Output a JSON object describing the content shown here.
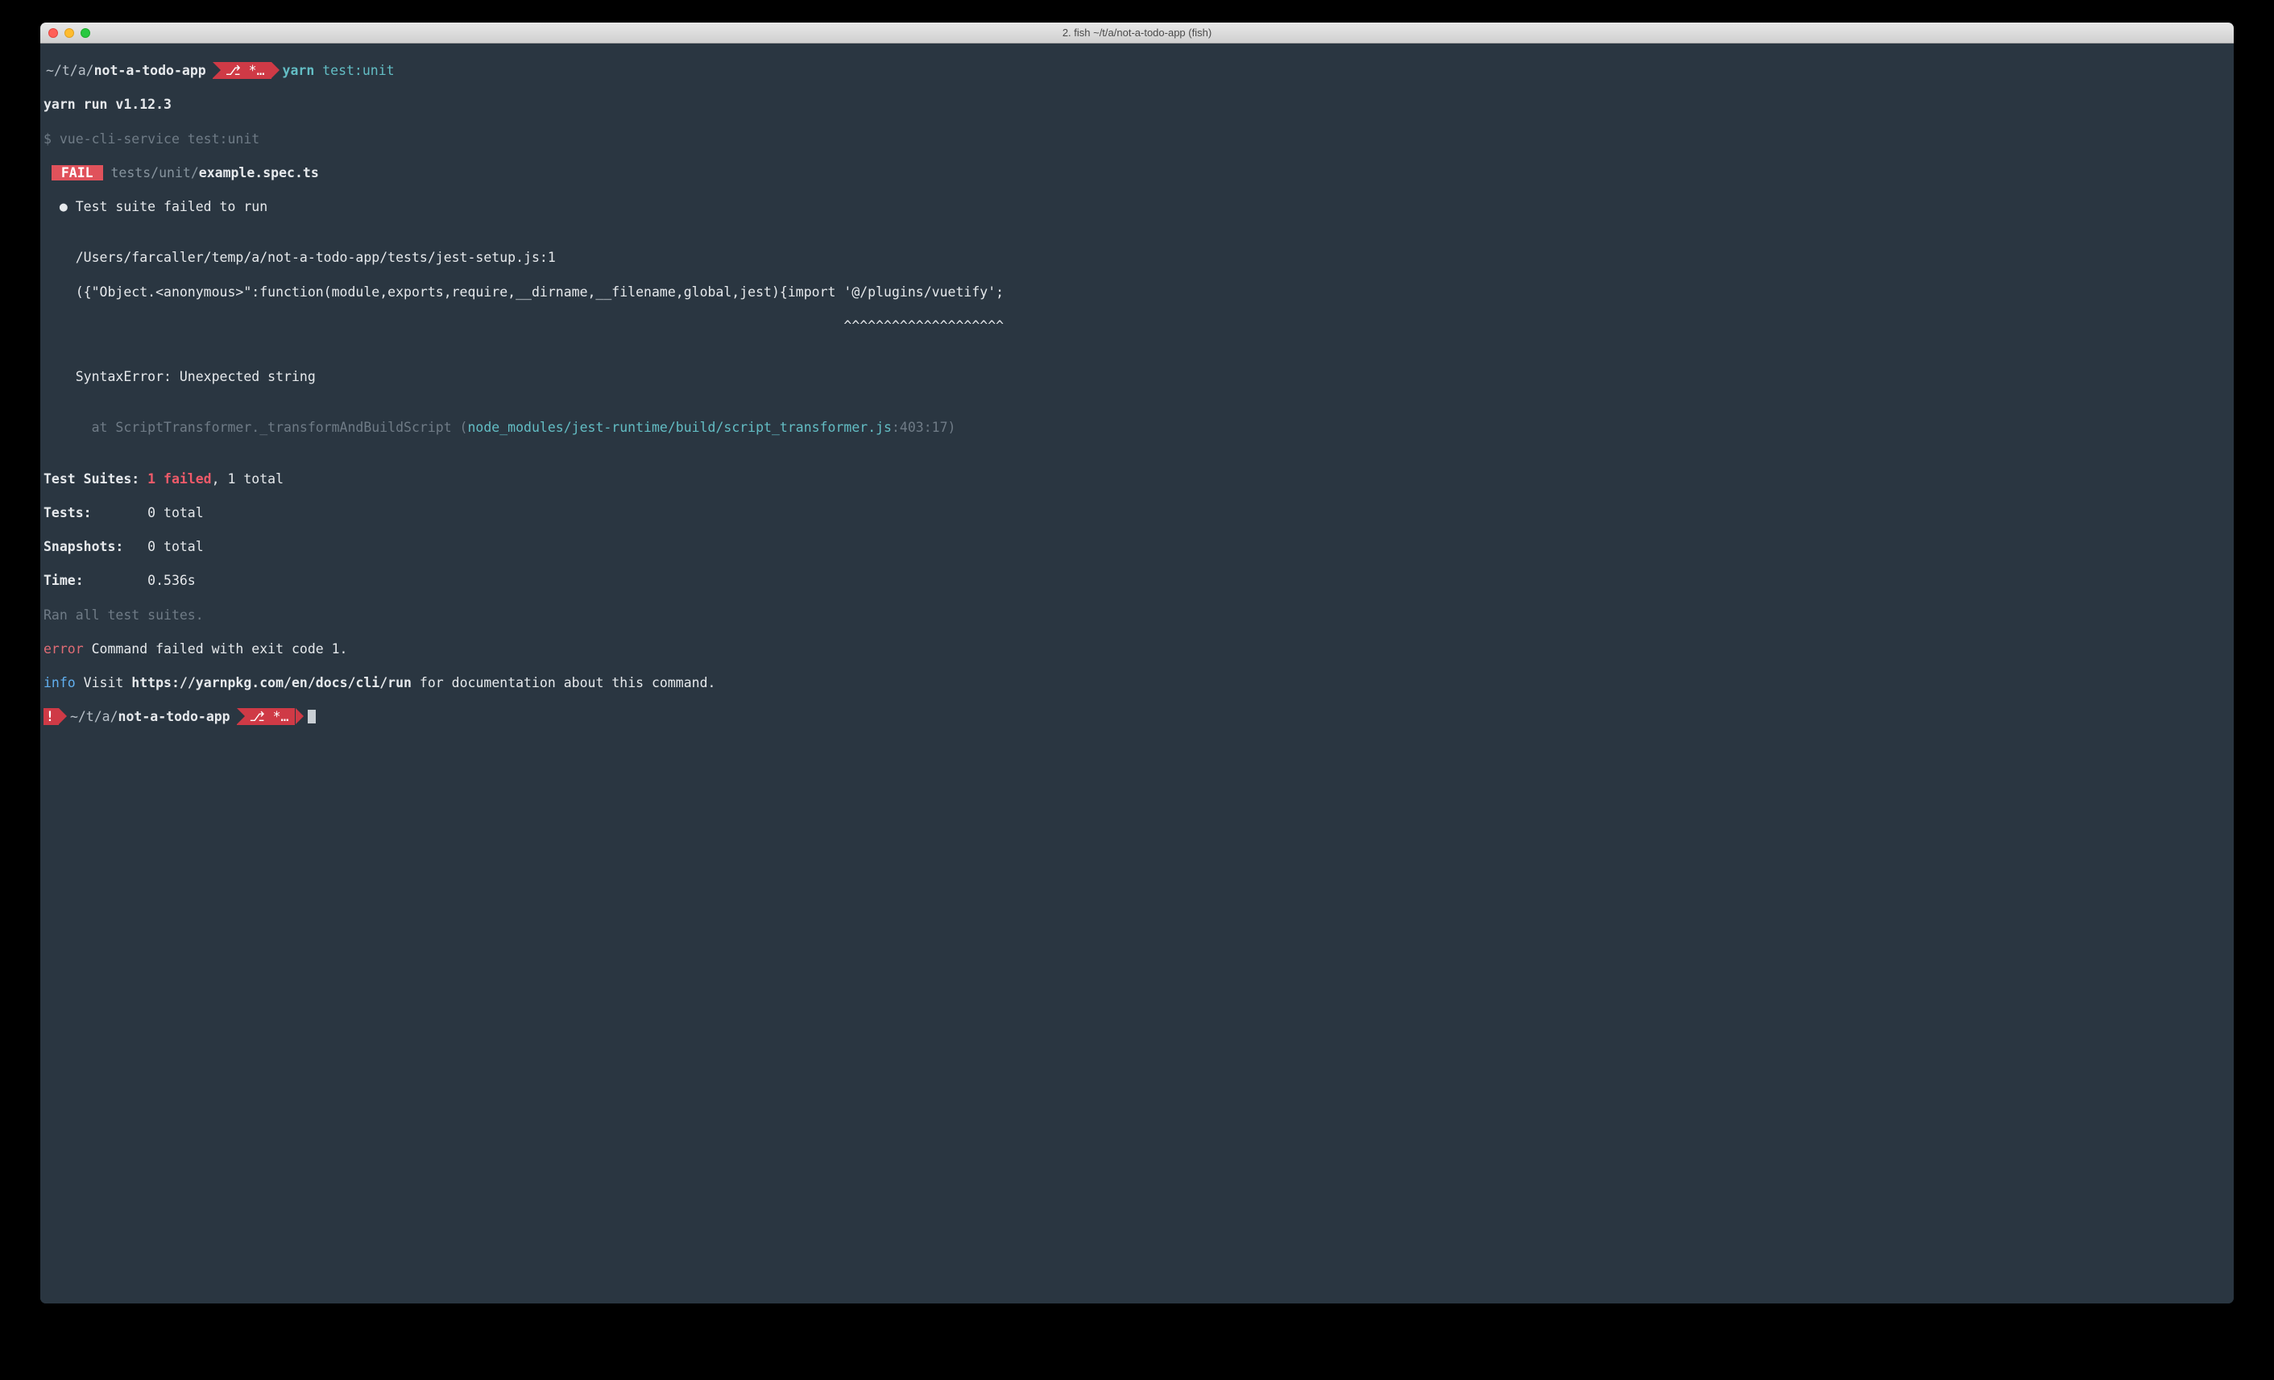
{
  "titlebar": {
    "title": "2. fish ~/t/a/not-a-todo-app (fish)"
  },
  "prompt1": {
    "path_head": "~/t/a/",
    "path_tail": "not-a-todo-app",
    "git": "⎇ *…",
    "cmd_bin": "yarn",
    "cmd_arg": " test:unit"
  },
  "prompt2": {
    "err": "!",
    "path_head": "~/t/a/",
    "path_tail": "not-a-todo-app",
    "git": "⎇ *…"
  },
  "out": {
    "yarn_run": "yarn run v1.12.3",
    "dollar_cmd": "$ vue-cli-service test:unit",
    "fail_label": " FAIL ",
    "fail_dir": "tests/unit/",
    "fail_file": "example.spec.ts",
    "suite_fail": "  ● Test suite failed to run",
    "blank": "",
    "path_line": "    /Users/farcaller/temp/a/not-a-todo-app/tests/jest-setup.js:1",
    "code_line": "    ({\"Object.<anonymous>\":function(module,exports,require,__dirname,__filename,global,jest){import '@/plugins/vuetify';",
    "caret_line": "                                                                                                    ^^^^^^^^^^^^^^^^^^^^",
    "syntax_err": "    SyntaxError: Unexpected string",
    "at_prefix": "      at ScriptTransformer._transformAndBuildScript (",
    "at_file": "node_modules/jest-runtime/build/script_transformer.js",
    "at_loc": ":403:17)",
    "summary": {
      "suites_label": "Test Suites: ",
      "suites_fail": "1 failed",
      "suites_rest": ", 1 total",
      "tests_label": "Tests:       ",
      "tests_val": "0 total",
      "snap_label": "Snapshots:   ",
      "snap_val": "0 total",
      "time_label": "Time:        ",
      "time_val": "0.536s"
    },
    "ran": "Ran all test suites.",
    "err_label": "error",
    "err_msg": " Command failed with exit code 1.",
    "info_label": "info",
    "info_pre": " Visit ",
    "info_url": "https://yarnpkg.com/en/docs/cli/run",
    "info_post": " for documentation about this command."
  }
}
